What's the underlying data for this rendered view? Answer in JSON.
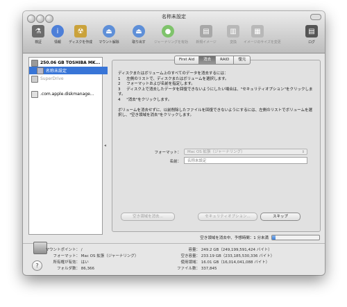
{
  "window": {
    "title": "名称未設定"
  },
  "toolbar": {
    "items": [
      {
        "label": "検証",
        "icon": "microscope-icon",
        "color": "#6b6b6b"
      },
      {
        "label": "情報",
        "icon": "info-icon",
        "color": "#4d7fd8"
      },
      {
        "label": "ディスクを作成",
        "icon": "burn-disc-icon",
        "color": "#caa23b"
      },
      {
        "label": "マウント解除",
        "icon": "unmount-icon",
        "color": "#5e8fd8"
      },
      {
        "label": "取り出す",
        "icon": "eject-icon",
        "color": "#5e8fd8"
      },
      {
        "label": "ジャーナリングを有効",
        "icon": "journal-icon",
        "color": "#7fc36b"
      },
      {
        "label": "新規イメージ",
        "icon": "new-image-icon",
        "color": "#a8a8a8"
      },
      {
        "label": "変換",
        "icon": "convert-icon",
        "color": "#b8b8b8"
      },
      {
        "label": "イメージのサイズを変更",
        "icon": "resize-image-icon",
        "color": "#b8b8b8"
      },
      {
        "label": "ログ",
        "icon": "log-icon",
        "color": "#555555"
      }
    ]
  },
  "sidebar": {
    "items": [
      {
        "label": "250.06 GB TOSHIBA MK...",
        "state": "normal",
        "bold": true
      },
      {
        "label": "名称未設定",
        "state": "selected",
        "bold": false
      },
      {
        "label": "SuperDrive",
        "state": "dim",
        "bold": false
      },
      {
        "label": ".com.apple.diskmanage...",
        "state": "normal",
        "bold": false
      }
    ]
  },
  "tabs": [
    {
      "label": "First Aid",
      "active": false
    },
    {
      "label": "消去",
      "active": true
    },
    {
      "label": "RAID",
      "active": false
    },
    {
      "label": "復元",
      "active": false
    }
  ],
  "erase": {
    "instructions": "ディスクまたはボリューム上のすべてのデータを消去するには：\n1     左側のリストで、ディスクまたはボリュームを選択します。\n2     フォーマットおよび名前を指定します。\n3     ディスク上で消去したデータを回復できないようにしたい場合は、\"セキュリティオプション\"をクリックします。\n4     \"消去\"をクリックします。\n\nボリュームを消去せずに、以前削除したファイルを回復できないようにするには、左側のリストでボリュームを選択し、\"空き領域を消去\"をクリックします。",
    "format_label": "フォーマット：",
    "format_value": "Mac OS 拡張（ジャーナリング）",
    "name_label": "名前：",
    "name_value": "名称未設定",
    "buttons": {
      "erase_free_space": "空き領域を消去...",
      "security_options": "セキュリティオプション...",
      "skip": "スキップ"
    },
    "progress_text": "空き領域を消去中、予想時間：1 分未満",
    "progress_value": 0.08
  },
  "info": {
    "left": [
      {
        "key": "マウントポイント：",
        "value": "/"
      },
      {
        "key": "フォーマット：",
        "value": "Mac OS 拡張（ジャーナリング）"
      },
      {
        "key": "所有権が有効：",
        "value": "はい"
      },
      {
        "key": "フォルダ数：",
        "value": "86,366"
      }
    ],
    "right": [
      {
        "key": "容量：",
        "value": "249.2 GB（249,199,591,424 バイト）"
      },
      {
        "key": "空き容量：",
        "value": "233.19 GB（233,185,530,336 バイト）"
      },
      {
        "key": "使用領域：",
        "value": "16.01 GB（16,014,041,088 バイト）"
      },
      {
        "key": "ファイル数：",
        "value": "337,845"
      }
    ]
  },
  "help_symbol": "?"
}
